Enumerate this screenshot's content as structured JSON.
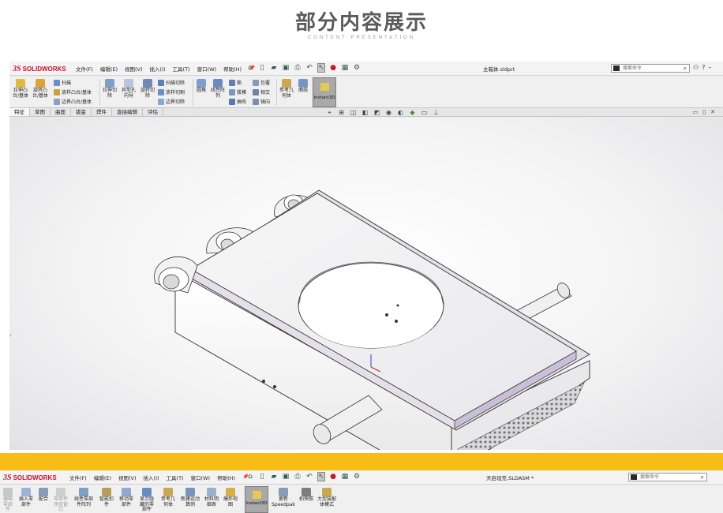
{
  "header": {
    "title": "部分内容展示",
    "subtitle": "CONTENT PRESENTATION"
  },
  "window1": {
    "brand": "SOLIDWORKS",
    "menu": [
      "文件(F)",
      "编辑(E)",
      "视图(V)",
      "插入(I)",
      "工具(T)",
      "窗口(W)",
      "帮助(H)"
    ],
    "document_title": "主箱体.sldprt",
    "search_placeholder": "搜索命令",
    "ribbon": {
      "extrude_boss": "拉伸凸台/基体",
      "revolve_boss": "旋转凸台/基体",
      "sweep": "扫描",
      "loft_boss": "放样凸台/基体",
      "boundary_boss": "边界凸台/基体",
      "extrude_cut": "拉伸切除",
      "hole_wizard": "异型孔向导",
      "revolve_cut": "旋转切除",
      "sweep_cut": "扫描切除",
      "loft_cut": "放样切割",
      "boundary_cut": "边界切除",
      "fillet": "圆角",
      "linear_pattern": "线性阵列",
      "rib": "筋",
      "draft": "拔模",
      "shell": "抽壳",
      "wrap": "包覆",
      "intersect": "相交",
      "mirror": "镜向",
      "reference_geometry": "参考几何体",
      "curves": "曲线",
      "instant3d": "Instant3D"
    },
    "tabs": [
      "特征",
      "草图",
      "曲面",
      "钣金",
      "焊件",
      "直接编辑",
      "评估"
    ],
    "active_tab": "特征"
  },
  "window2": {
    "brand": "SOLIDWORKS",
    "menu": [
      "文件(F)",
      "编辑(E)",
      "视图(V)",
      "插入(I)",
      "工具(T)",
      "窗口(W)",
      "帮助(H)"
    ],
    "document_title": "天启坦克.SLDASM *",
    "search_placeholder": "搜索命令",
    "ribbon": {
      "edit_component": "编辑零部件",
      "insert_components": "插入零部件",
      "mate": "配合",
      "component_preview": "零部件预览窗口",
      "linear_component_pattern": "线性零部件阵列",
      "smart_fasteners": "智能扣件",
      "move_component": "移动零部件",
      "show_hidden": "显示隐藏的零部件",
      "reference_geometry": "参考几何体",
      "new_motion_study": "新建运动算例",
      "bill_of_materials": "材料明细表",
      "exploded_view": "爆炸视图",
      "instant3d": "Instant3D",
      "update_speedpak": "更新 Speedpak",
      "take_snapshot": "拍快照",
      "large_assembly_mode": "大型装配体模式"
    }
  }
}
